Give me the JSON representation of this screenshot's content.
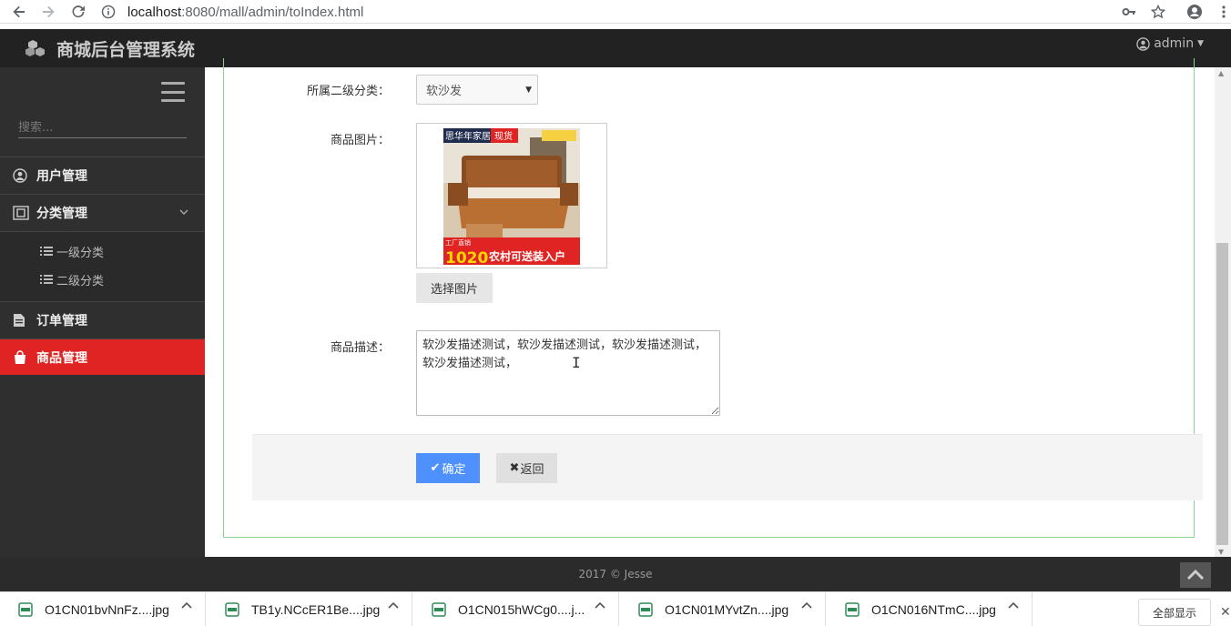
{
  "browser": {
    "url_host": "localhost",
    "url_path": ":8080/mall/admin/toIndex.html"
  },
  "app": {
    "title": "商城后台管理系统",
    "user": "admin"
  },
  "sidebar": {
    "search_placeholder": "搜索...",
    "items": [
      {
        "label": "用户管理",
        "icon": "user-circle-icon"
      },
      {
        "label": "分类管理",
        "icon": "category-icon"
      },
      {
        "label": "订单管理",
        "icon": "document-icon"
      },
      {
        "label": "商品管理",
        "icon": "shopping-bag-icon"
      }
    ],
    "subitems": [
      {
        "label": "一级分类",
        "icon": "list-icon"
      },
      {
        "label": "二级分类",
        "icon": "list-icon"
      }
    ],
    "active_color": "#e02424"
  },
  "form": {
    "category_label": "所属二级分类：",
    "category_value": "软沙发",
    "image_label": "商品图片：",
    "choose_image_label": "选择图片",
    "image_text": {
      "brand": "思华年家居",
      "badge": "现货",
      "promo_small": "工厂直销",
      "price": "1020",
      "promo": "农村可送装入户"
    },
    "desc_label": "商品描述：",
    "desc_value": "软沙发描述测试，软沙发描述测试，软沙发描述测试，软沙发描述测试，",
    "ok_label": "确定",
    "back_label": "返回"
  },
  "footer": {
    "text": "2017 © Jesse"
  },
  "downloads": {
    "files": [
      "O1CN01bvNnFz....jpg",
      "TB1y.NCcER1Be....jpg",
      "O1CN015hWCg0....j...",
      "O1CN01MYvtZn....jpg",
      "O1CN016NTmC....jpg"
    ],
    "show_all_label": "全部显示"
  }
}
